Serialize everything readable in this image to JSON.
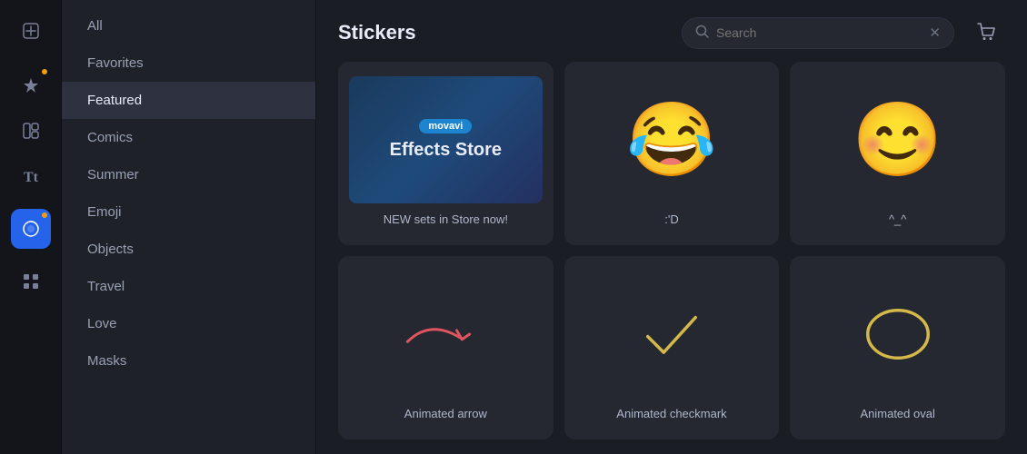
{
  "app": {
    "title": "Stickers"
  },
  "iconBar": {
    "icons": [
      {
        "name": "add-icon",
        "symbol": "+",
        "glyph": "⊞",
        "active": false,
        "dot": false
      },
      {
        "name": "pin-icon",
        "symbol": "📌",
        "glyph": "✦",
        "active": false,
        "dot": true
      },
      {
        "name": "layout-icon",
        "symbol": "▦",
        "glyph": "⊟",
        "active": false,
        "dot": false
      },
      {
        "name": "text-icon",
        "symbol": "T",
        "glyph": "Tt",
        "active": false,
        "dot": false
      },
      {
        "name": "sticker-icon",
        "symbol": "🌙",
        "glyph": "◑",
        "active": true,
        "dot": true
      },
      {
        "name": "grid-icon",
        "symbol": "⊞",
        "glyph": "⊞",
        "active": false,
        "dot": false
      }
    ]
  },
  "sidebar": {
    "items": [
      {
        "label": "All",
        "active": false
      },
      {
        "label": "Favorites",
        "active": false
      },
      {
        "label": "Featured",
        "active": true
      },
      {
        "label": "Comics",
        "active": false
      },
      {
        "label": "Summer",
        "active": false
      },
      {
        "label": "Emoji",
        "active": false
      },
      {
        "label": "Objects",
        "active": false
      },
      {
        "label": "Travel",
        "active": false
      },
      {
        "label": "Love",
        "active": false
      },
      {
        "label": "Masks",
        "active": false
      }
    ]
  },
  "search": {
    "placeholder": "Search",
    "value": ""
  },
  "stickers": {
    "row1": [
      {
        "id": "effects-store",
        "type": "effects-store",
        "badge": "movavi",
        "title": "Effects Store",
        "label": "NEW sets in Store now!"
      },
      {
        "id": "crying-laugh",
        "type": "emoji",
        "emoji": "😂",
        "label": ":'D"
      },
      {
        "id": "smile",
        "type": "emoji",
        "emoji": "😊",
        "label": "^_^"
      }
    ],
    "row2": [
      {
        "id": "animated-arrow",
        "type": "arrow",
        "label": "Animated arrow"
      },
      {
        "id": "animated-checkmark",
        "type": "checkmark",
        "label": "Animated checkmark"
      },
      {
        "id": "animated-oval",
        "type": "oval",
        "label": "Animated oval"
      }
    ]
  }
}
